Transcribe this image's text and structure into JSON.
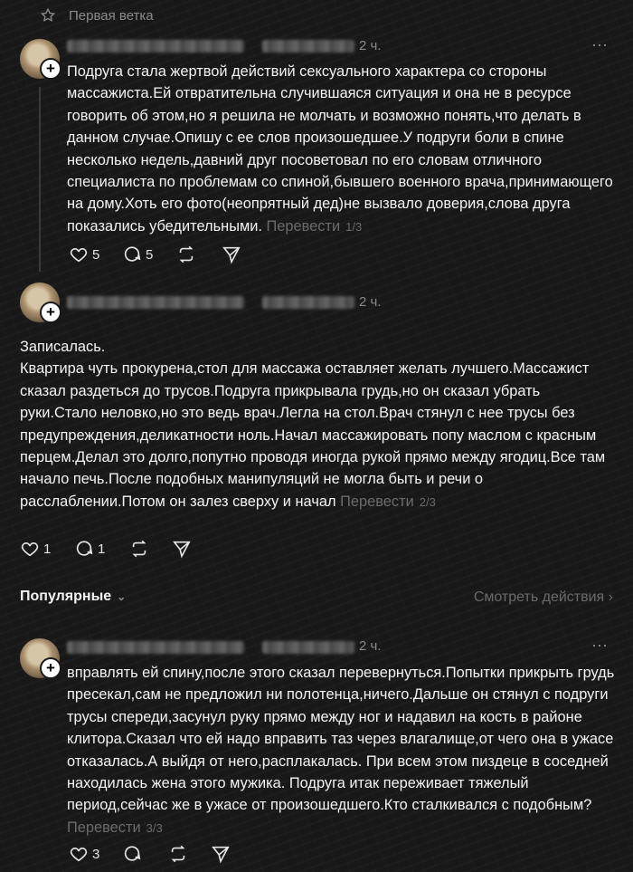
{
  "branch": {
    "label": "Первая ветка"
  },
  "posts": [
    {
      "time": "2 ч.",
      "text": "Подруга стала жертвой действий сексуального характера со стороны массажиста.Ей отвратительна случившаяся ситуация и она не в ресурсе говорить об этом,но я решила не молчать и возможно понять,что делать в данном случае.Опишу с ее слов произошедшее.У подруги боли в спине несколько недель,давний друг посоветовал по его словам отличного специалиста по проблемам со спиной,бывшего военного врача,принимающего на дому.Хоть его фото(неопрятный дед)не вызвало доверия,слова друга показались убедительными.",
      "translate": "Перевести",
      "page": "1/3",
      "likes": "5",
      "replies": "5"
    },
    {
      "time": "2 ч.",
      "text": "Записалась.\nКвартира чуть прокурена,стол для массажа оставляет желать лучшего.Массажист сказал раздеться до трусов.Подруга прикрывала грудь,но он сказал убрать руки.Стало неловко,но это ведь врач.Легла на стол.Врач стянул с нее трусы без предупреждения,деликатности ноль.Начал массажировать попу маслом с красным перцем.Делал это долго,попутно проводя иногда рукой прямо между ягодиц.Все там начало печь.После подобных манипуляций не могла быть и речи о расслаблении.Потом он залез сверху и начал",
      "translate": "Перевести",
      "page": "2/3",
      "likes": "1",
      "replies": "1"
    },
    {
      "time": "2 ч.",
      "text": "вправлять ей спину,после этого сказал перевернуться.Попытки прикрыть грудь пресекал,сам не предложил ни полотенца,ничего.Дальше он стянул с подруги трусы спереди,засунул руку прямо между ног и надавил на кость в районе клитора.Сказал что ей надо вправить таз через влагалище,от чего она в ужасе отказалась.А выйдя от него,расплакалась. При всем этом пиздеце в соседней находилась жена этого мужика. Подруга итак переживает тяжелый период,сейчас же в ужасе от произошедшего.Кто сталкивался с подобным?",
      "translate": "Перевести",
      "page": "3/3",
      "likes": "3",
      "replies": ""
    }
  ],
  "popular": {
    "label": "Популярные",
    "see_actions": "Смотреть действия"
  },
  "icons": {
    "more": "⋯",
    "plus": "+",
    "chevron": "⌄",
    "chevron_right": "›"
  }
}
